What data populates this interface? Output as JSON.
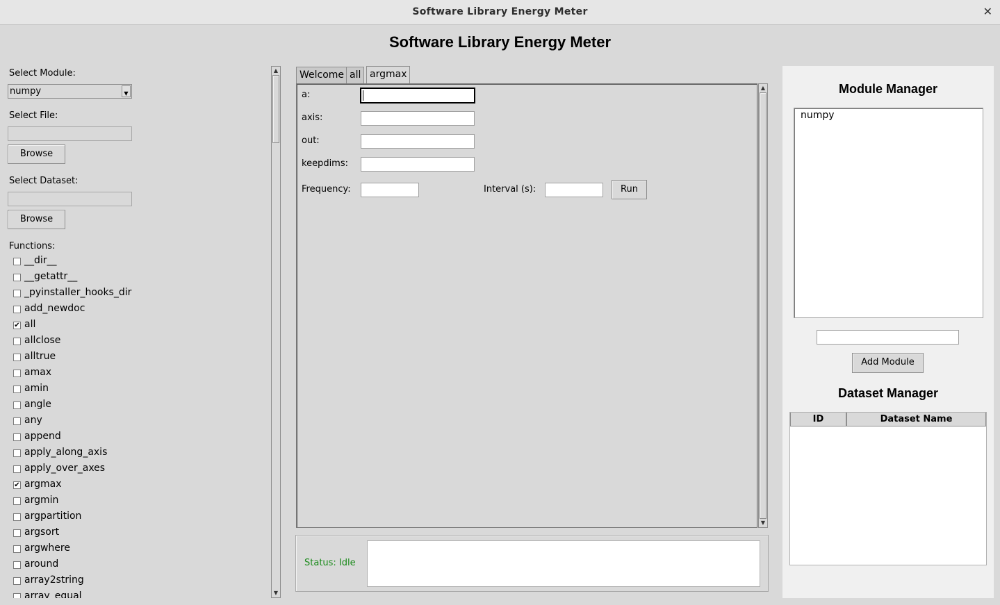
{
  "window": {
    "title": "Software Library Energy Meter",
    "close_glyph": "✕"
  },
  "app": {
    "title": "Software Library Energy Meter"
  },
  "left": {
    "select_module_label": "Select Module:",
    "module_value": "numpy",
    "select_file_label": "Select File:",
    "file_value": "",
    "browse_label": "Browse",
    "select_dataset_label": "Select Dataset:",
    "dataset_value": "",
    "functions_label": "Functions:",
    "functions": [
      {
        "name": "__dir__",
        "checked": false
      },
      {
        "name": "__getattr__",
        "checked": false
      },
      {
        "name": "_pyinstaller_hooks_dir",
        "checked": false
      },
      {
        "name": "add_newdoc",
        "checked": false
      },
      {
        "name": "all",
        "checked": true
      },
      {
        "name": "allclose",
        "checked": false
      },
      {
        "name": "alltrue",
        "checked": false
      },
      {
        "name": "amax",
        "checked": false
      },
      {
        "name": "amin",
        "checked": false
      },
      {
        "name": "angle",
        "checked": false
      },
      {
        "name": "any",
        "checked": false
      },
      {
        "name": "append",
        "checked": false
      },
      {
        "name": "apply_along_axis",
        "checked": false
      },
      {
        "name": "apply_over_axes",
        "checked": false
      },
      {
        "name": "argmax",
        "checked": true
      },
      {
        "name": "argmin",
        "checked": false
      },
      {
        "name": "argpartition",
        "checked": false
      },
      {
        "name": "argsort",
        "checked": false
      },
      {
        "name": "argwhere",
        "checked": false
      },
      {
        "name": "around",
        "checked": false
      },
      {
        "name": "array2string",
        "checked": false
      },
      {
        "name": "array_equal",
        "checked": false
      }
    ]
  },
  "tabs": [
    {
      "label": "Welcome",
      "active": false
    },
    {
      "label": "all",
      "active": false
    },
    {
      "label": "argmax",
      "active": true
    }
  ],
  "form": {
    "params": [
      {
        "label": "a:",
        "value": ""
      },
      {
        "label": "axis:",
        "value": ""
      },
      {
        "label": "out:",
        "value": ""
      },
      {
        "label": "keepdims:",
        "value": ""
      }
    ],
    "frequency_label": "Frequency:",
    "frequency_value": "",
    "interval_label": "Interval (s):",
    "interval_value": "",
    "run_label": "Run"
  },
  "status": {
    "text": "Status: Idle",
    "color": "#1a8a1a",
    "output": ""
  },
  "module_manager": {
    "title": "Module Manager",
    "modules": [
      "numpy"
    ],
    "new_module_value": "",
    "add_label": "Add Module"
  },
  "dataset_manager": {
    "title": "Dataset Manager",
    "columns": [
      "ID",
      "Dataset Name"
    ],
    "rows": []
  },
  "icons": {
    "close": "close-icon",
    "combo_arrow": "chevron-down-icon",
    "scroll_up": "arrow-up-icon",
    "scroll_down": "arrow-down-icon",
    "check": "checkmark-icon"
  }
}
